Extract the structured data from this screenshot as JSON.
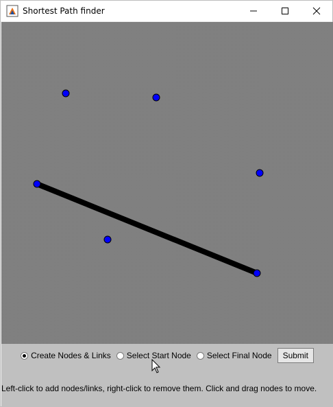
{
  "window": {
    "title": "Shortest Path finder"
  },
  "graph": {
    "canvas_color": "#808080",
    "node_color": "#0000ff",
    "link_color": "#000000"
  },
  "controls": {
    "modes": [
      {
        "label": "Create Nodes & Links",
        "selected": true
      },
      {
        "label": "Select Start Node",
        "selected": false
      },
      {
        "label": "Select Final Node",
        "selected": false
      }
    ],
    "submit_label": "Submit",
    "help_text": "Left-click to add nodes/links, right-click to remove them.  Click and drag nodes to move."
  }
}
